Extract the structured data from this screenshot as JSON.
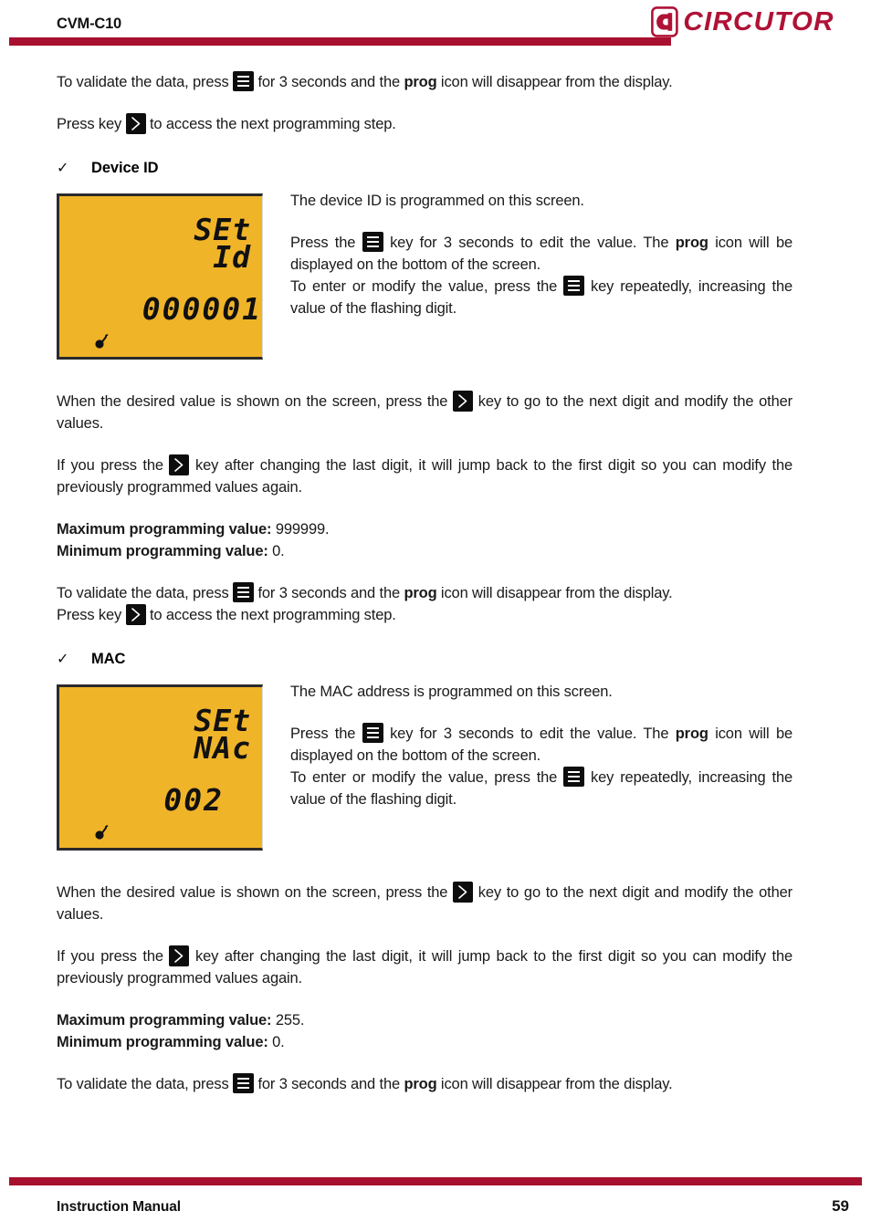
{
  "header": {
    "title": "CVM-C10",
    "logo_text": "CIRCUTOR",
    "brand_color": "#B01236",
    "rule_color": "#A8102F"
  },
  "intro": {
    "validate_p1": "To validate the data, press ",
    "validate_p2": " for 3 seconds and the ",
    "validate_bold": "prog",
    "validate_p3": " icon will disappear from the display.",
    "nextstep_p1": "Press key ",
    "nextstep_p2": " to access the next programming step."
  },
  "sections": [
    {
      "bullet": "✓",
      "label": "Device ID",
      "lcd": {
        "line1": "SEt",
        "line2": "Id",
        "value": "000001",
        "background": "#F0B429",
        "key_icon": "key-icon"
      },
      "side": {
        "intro": "The device ID is programmed on this screen.",
        "edit_p1": "Press the ",
        "edit_p2": " key for 3 seconds to edit the value. The ",
        "edit_bold": "prog",
        "edit_p3": " icon will be displayed on the bottom of the screen.",
        "modify_p1": "To enter or modify the value, press the ",
        "modify_p2": " key repeatedly, increasing the value of the flashing digit."
      },
      "after": {
        "desired_p1": "When the desired value is shown on the screen, press the ",
        "desired_p2": " key to go to the next digit and modify the other values.",
        "jump_p1": "If you press the ",
        "jump_p2": " key after changing the last digit, it will jump back to the first digit so you can modify the previously programmed values again.",
        "max_label": "Maximum programming value:",
        "max_value": " 999999.",
        "min_label": "Minimum programming value:",
        "min_value": " 0.",
        "validate_p1": "To validate the data, press ",
        "validate_p2": " for 3 seconds and the ",
        "validate_bold": "prog",
        "validate_p3": " icon will disappear from the display.",
        "nextstep_p1": "Press key ",
        "nextstep_p2": " to access the next programming step."
      }
    },
    {
      "bullet": "✓",
      "label": "MAC",
      "lcd": {
        "line1": "SEt",
        "line2": "NAc",
        "value": "002",
        "background": "#F0B429",
        "key_icon": "key-icon"
      },
      "side": {
        "intro": "The MAC address is programmed on this screen.",
        "edit_p1": "Press the ",
        "edit_p2": " key for 3 seconds to edit the value. The ",
        "edit_bold": "prog",
        "edit_p3": " icon will be displayed on the bottom of the screen.",
        "modify_p1": "To enter or modify the value, press the ",
        "modify_p2": " key repeatedly, increasing the value of the flashing digit."
      },
      "after": {
        "desired_p1": "When the desired value is shown on the screen, press the ",
        "desired_p2": " key to go to the next digit and modify the other values.",
        "jump_p1": "If you press the ",
        "jump_p2": " key after changing the last digit, it will jump back to the first digit so you can modify the previously programmed values again.",
        "max_label": "Maximum programming value:",
        "max_value": " 255.",
        "min_label": "Minimum programming value:",
        "min_value": " 0.",
        "validate_p1": "To validate the data, press ",
        "validate_p2": " for 3 seconds and the ",
        "validate_bold": "prog",
        "validate_p3": " icon will disappear from the display."
      }
    }
  ],
  "footer": {
    "left": "Instruction Manual",
    "page_number": "59"
  }
}
